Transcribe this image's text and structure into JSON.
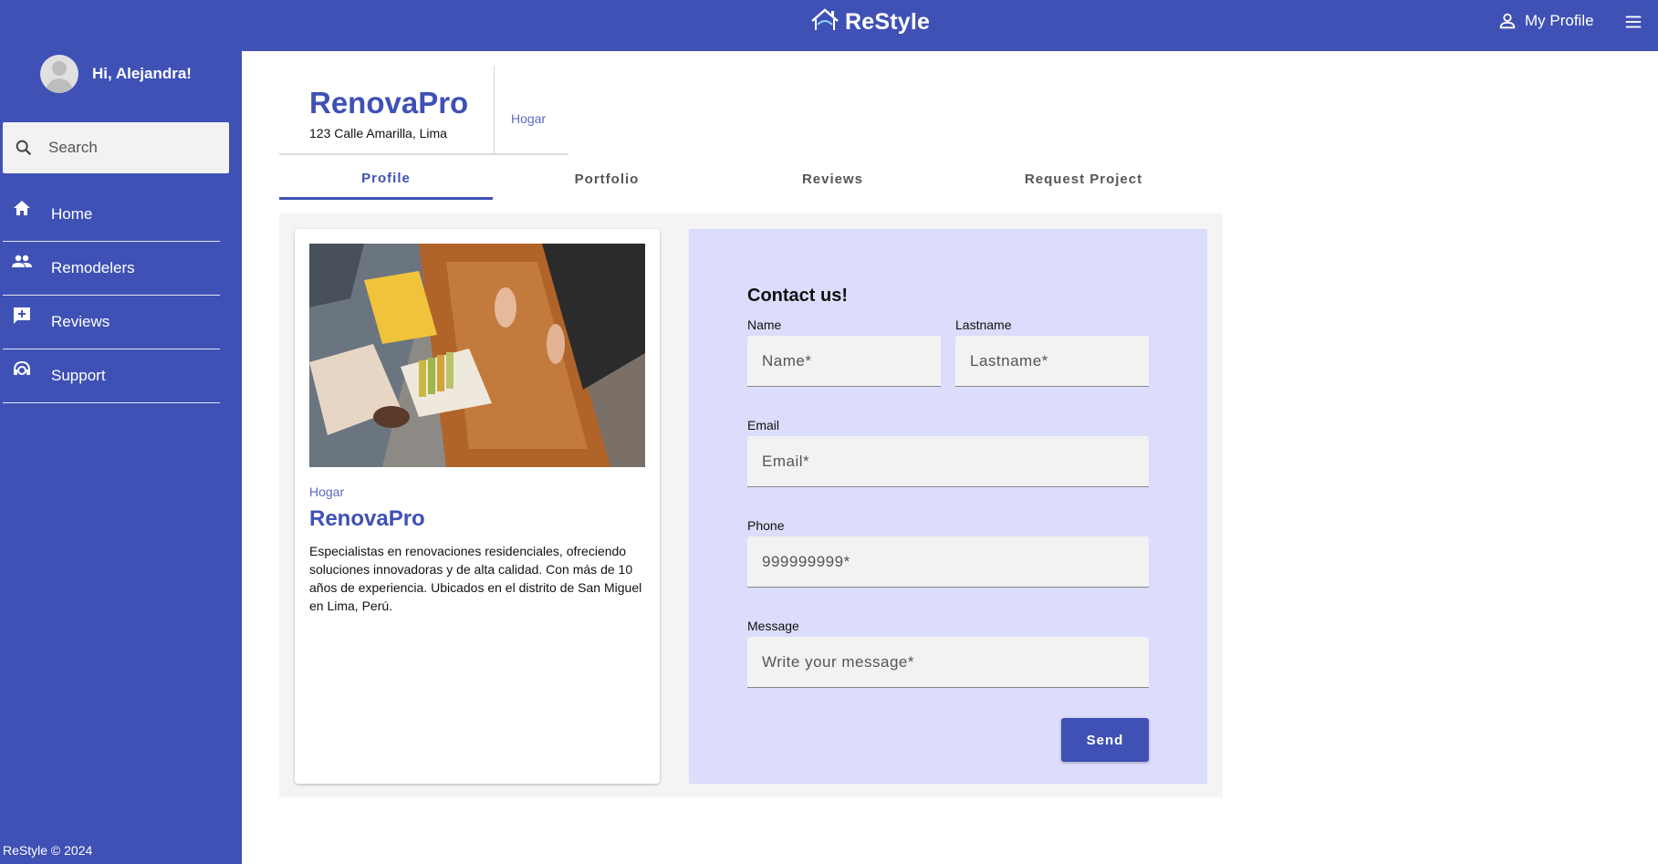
{
  "topbar": {
    "brand_name": "ReStyle",
    "brand_sub": "RESTYLE",
    "my_profile_label": "My Profile"
  },
  "sidebar": {
    "greeting": "Hi, Alejandra!",
    "search_placeholder": "Search",
    "items": [
      {
        "label": "Home",
        "icon": "home-icon"
      },
      {
        "label": "Remodelers",
        "icon": "people-icon"
      },
      {
        "label": "Reviews",
        "icon": "rate-review-icon"
      },
      {
        "label": "Support",
        "icon": "support-agent-icon"
      }
    ],
    "footer": "ReStyle © 2024"
  },
  "business": {
    "name": "RenovaPro",
    "address": "123 Calle Amarilla, Lima",
    "category": "Hogar"
  },
  "tabs": [
    {
      "label": "Profile",
      "active": true
    },
    {
      "label": "Portfolio",
      "active": false
    },
    {
      "label": "Reviews",
      "active": false
    },
    {
      "label": "Request Project",
      "active": false
    }
  ],
  "card": {
    "category": "Hogar",
    "title": "RenovaPro",
    "description": "Especialistas en renovaciones residenciales, ofreciendo soluciones innovadoras y de alta calidad. Con más de 10 años de experiencia. Ubicados en el distrito de San Miguel en Lima, Perú."
  },
  "contact": {
    "title": "Contact us!",
    "name_label": "Name",
    "name_placeholder": "Name*",
    "lastname_label": "Lastname",
    "lastname_placeholder": "Lastname*",
    "email_label": "Email",
    "email_placeholder": "Email*",
    "phone_label": "Phone",
    "phone_placeholder": "999999999*",
    "message_label": "Message",
    "message_placeholder": "Write your message*",
    "send_label": "Send"
  },
  "colors": {
    "primary": "#3f51b5",
    "contact_bg": "#dcdcfc",
    "panel_bg": "#f4f4f4"
  }
}
